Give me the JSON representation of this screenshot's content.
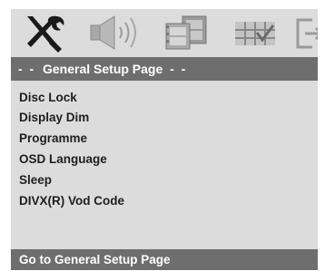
{
  "icon_tabs": [
    {
      "name": "tools-icon"
    },
    {
      "name": "speaker-icon"
    },
    {
      "name": "film-icon"
    },
    {
      "name": "preferences-grid-icon"
    },
    {
      "name": "exit-icon"
    }
  ],
  "page": {
    "title": "General Setup Page",
    "title_dashes_left": "- -",
    "title_dashes_right": "- -"
  },
  "menu": {
    "items": [
      {
        "label": "Disc Lock"
      },
      {
        "label": "Display Dim"
      },
      {
        "label": "Programme"
      },
      {
        "label": "OSD Language"
      },
      {
        "label": "Sleep"
      },
      {
        "label": "DIVX(R) Vod Code"
      }
    ]
  },
  "status": {
    "text": "Go to General Setup Page"
  },
  "colors": {
    "background": "#dcdcdc",
    "bar": "#6e6e6e",
    "text": "#1e1e1e",
    "bar_text": "#ffffff"
  }
}
